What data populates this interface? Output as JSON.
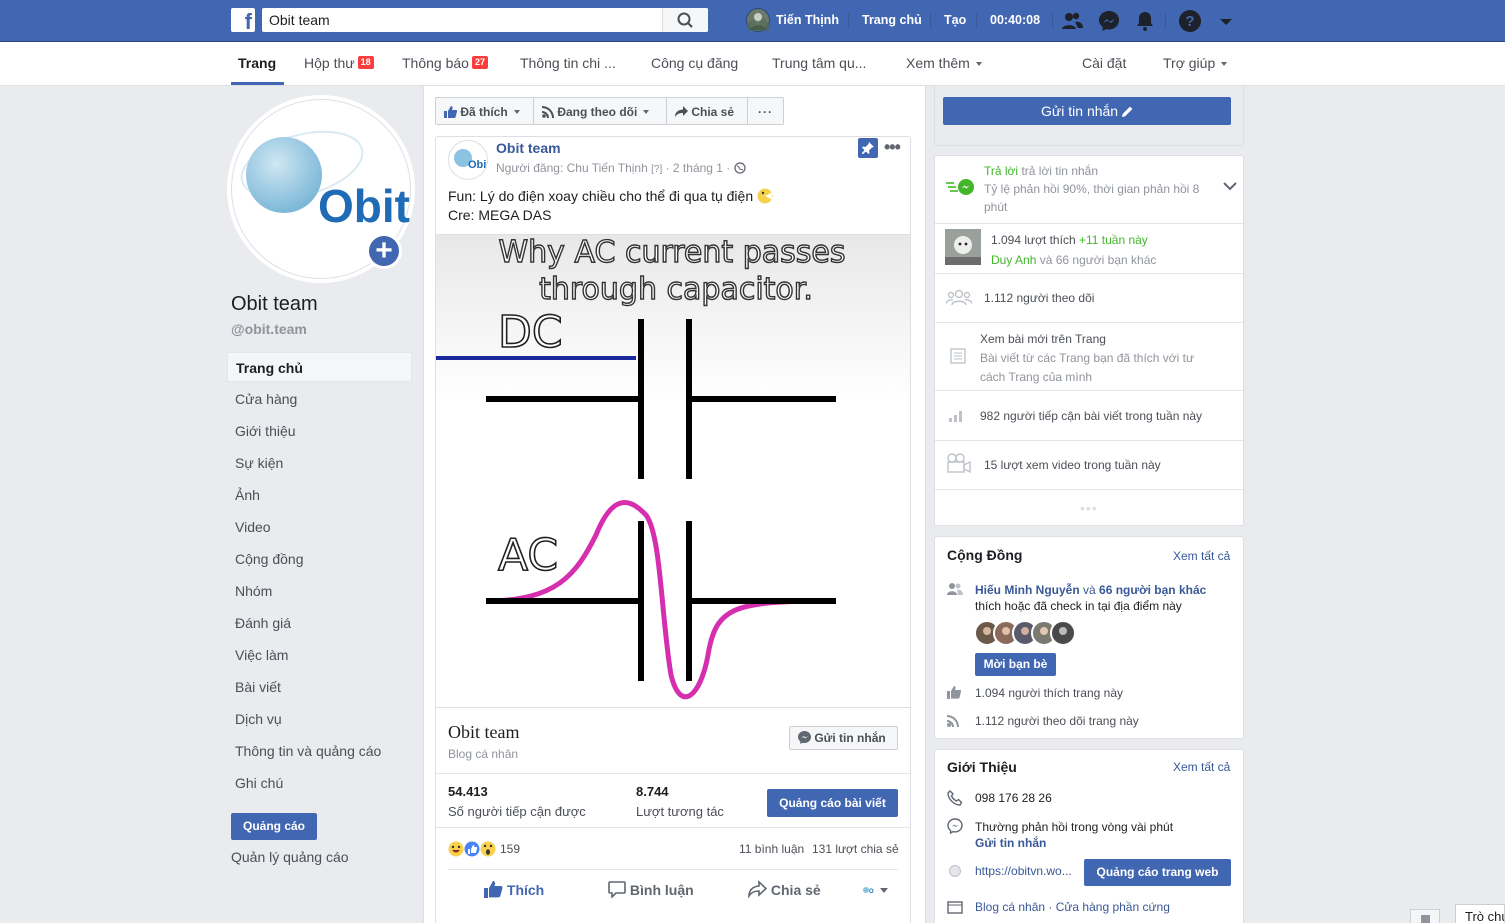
{
  "topbar": {
    "logo": "f",
    "search_value": "Obit team",
    "user_name": "Tiến Thịnh",
    "home": "Trang chủ",
    "create": "Tạo",
    "time": "00:40:08"
  },
  "pagenav": {
    "tabs": [
      {
        "label": "Trang"
      },
      {
        "label": "Hộp thư",
        "badge": "18"
      },
      {
        "label": "Thông báo",
        "badge": "27"
      },
      {
        "label": "Thông tin chi ..."
      },
      {
        "label": "Công cụ đăng"
      },
      {
        "label": "Trung tâm qu..."
      },
      {
        "label": "Xem thêm"
      }
    ],
    "settings": "Cài đặt",
    "help": "Trợ giúp"
  },
  "left": {
    "logo_text": "Obit",
    "page_name": "Obit team",
    "username": "@obit.team",
    "nav": [
      "Trang chủ",
      "Cửa hàng",
      "Giới thiệu",
      "Sự kiện",
      "Ảnh",
      "Video",
      "Cộng đồng",
      "Nhóm",
      "Đánh giá",
      "Việc làm",
      "Bài viết",
      "Dịch vụ",
      "Thông tin và quảng cáo",
      "Ghi chú"
    ],
    "promote": "Quảng cáo",
    "manage_ads": "Quản lý quảng cáo"
  },
  "actions": {
    "liked": "Đã thích",
    "following": "Đang theo dõi",
    "share": "Chia sẻ",
    "more": "···",
    "send_message": "Gửi tin nhắn"
  },
  "post": {
    "page_name": "Obit team",
    "logo_text": "Obit",
    "meta_author": "Người đăng: Chu Tiến Thịnh",
    "meta_q": "[?]",
    "meta_time": "· 2 tháng 1 ·",
    "text_line1": "Fun: Lý do điện xoay chiều cho thể đi qua tụ điện",
    "text_line2": "Cre: MEGA DAS",
    "image": {
      "title_line1": "Why AC current passes",
      "title_line2": "through capacitor.",
      "label_dc": "DC",
      "label_ac": "AC"
    },
    "footer_name": "Obit team",
    "footer_sub": "Blog cá nhân",
    "footer_btn": "Gửi tin nhắn",
    "reach_value": "54.413",
    "reach_label": "Số người tiếp cận được",
    "engage_value": "8.744",
    "engage_label": "Lượt tương tác",
    "boost": "Quảng cáo bài viết",
    "reactions_count": "159",
    "comments": "11 bình luận",
    "shares": "131 lượt chia sẻ",
    "like": "Thích",
    "comment": "Bình luận",
    "share": "Chia sẻ"
  },
  "right": {
    "reply_label": "Trả lời",
    "reply_sub": "trả lời tin nhắn",
    "reply_rate": "Tỷ lệ phản hồi 90%, thời gian phản hồi 8 phút",
    "likes_count": "1.094 lượt thích",
    "likes_week": "+11 tuần này",
    "likes_friend": "Duy Anh",
    "likes_others": "và 66 người bạn khác",
    "followers": "1.112 người theo dõi",
    "see_first_title": "Xem bài mới trên Trang",
    "see_first_desc": "Bài viết từ các Trang bạn đã thích với tư cách Trang của mình",
    "reach_week": "982 người tiếp cận bài viết trong tuần này",
    "video_views": "15 lượt xem video trong tuần này",
    "community_title": "Cộng Đồng",
    "see_all": "Xem tất cả",
    "community_friend": "Hiếu Minh Nguyễn",
    "community_and": "và",
    "community_others": "66 người bạn khác",
    "community_desc": "thích hoặc đã check in tại địa điểm này",
    "invite": "Mời bạn bè",
    "community_likes": "1.094 người thích trang này",
    "community_follows": "1.112 người theo dõi trang này",
    "about_title": "Giới Thiệu",
    "about_see_all": "Xem tất cả",
    "phone": "098 176 28 26",
    "response_time": "Thường phản hồi trong vòng vài phút",
    "send_message": "Gửi tin nhắn",
    "website": "https://obitvn.wo...",
    "website_ad": "Quảng cáo trang web",
    "categories": "Blog cá nhân · Cửa hàng phần cứng",
    "chat_label": "Trò chu"
  }
}
